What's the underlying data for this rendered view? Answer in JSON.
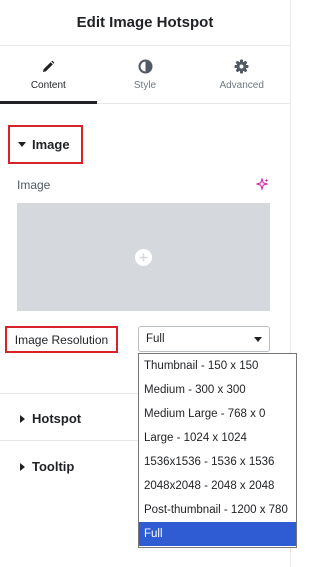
{
  "header": {
    "title": "Edit Image Hotspot"
  },
  "tabs": [
    {
      "label": "Content",
      "icon": "pencil-icon",
      "active": true
    },
    {
      "label": "Style",
      "icon": "half-circle-icon",
      "active": false
    },
    {
      "label": "Advanced",
      "icon": "gear-icon",
      "active": false
    }
  ],
  "sections": {
    "image": {
      "title": "Image",
      "expanded": true
    },
    "hotspot": {
      "title": "Hotspot",
      "expanded": false
    },
    "tooltip": {
      "title": "Tooltip",
      "expanded": false
    }
  },
  "image_field": {
    "label": "Image",
    "ai_icon": "sparkle-icon",
    "add_icon": "plus-circle-icon"
  },
  "resolution": {
    "label": "Image Resolution",
    "value": "Full",
    "options": [
      "Thumbnail - 150 x 150",
      "Medium - 300 x 300",
      "Medium Large - 768 x 0",
      "Large - 1024 x 1024",
      "1536x1536 - 1536 x 1536",
      "2048x2048 - 2048 x 2048",
      "Post-thumbnail - 1200 x 780",
      "Full"
    ],
    "selected_index": 7
  },
  "colors": {
    "highlight_border": "#d6232a",
    "selected_option": "#2f5bd3",
    "ai_icon": "#c72aa6"
  }
}
